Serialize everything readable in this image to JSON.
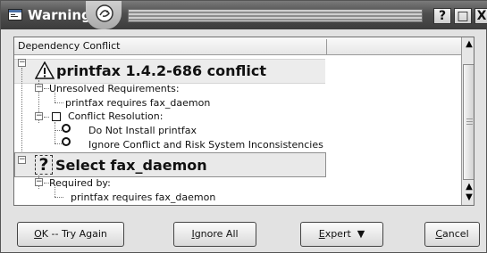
{
  "window": {
    "title": "Warning"
  },
  "titlebar_buttons": [
    {
      "name": "help",
      "glyph": "?"
    },
    {
      "name": "maximize",
      "glyph": "□"
    },
    {
      "name": "close",
      "glyph": "X"
    }
  ],
  "list": {
    "columns": [
      "Dependency Conflict",
      ""
    ],
    "conflict": {
      "title": "printfax 1.4.2-686 conflict",
      "unresolved_label": "Unresolved Requirements:",
      "unresolved_item": "printfax requires fax_daemon",
      "resolution_label": "Conflict Resolution:",
      "options": [
        "Do Not Install printfax",
        "Ignore Conflict and Risk System Inconsistencies"
      ]
    },
    "select": {
      "title": "Select fax_daemon",
      "required_label": "Required by:",
      "required_item": "printfax requires fax_daemon"
    }
  },
  "buttons": {
    "ok_accel": "O",
    "ok_rest": "K -- Try Again",
    "ignore_accel": "I",
    "ignore_rest": "gnore All",
    "expert_accel": "E",
    "expert_rest": "xpert",
    "expert_arrow": "▼",
    "cancel_accel": "C",
    "cancel_rest": "ancel"
  }
}
